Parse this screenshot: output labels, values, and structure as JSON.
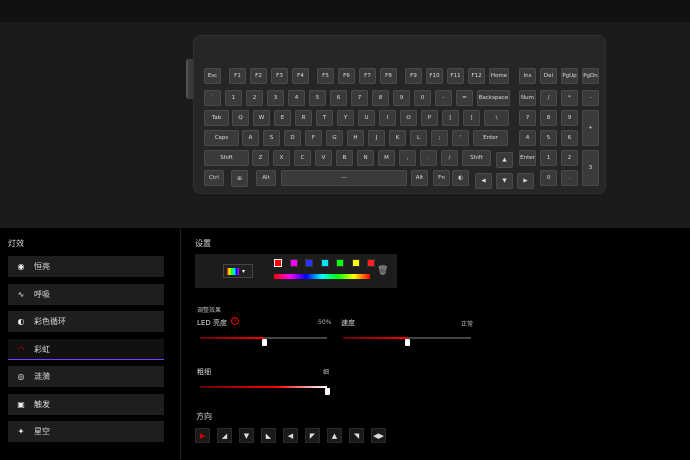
{
  "keyboard": {
    "rows": [
      [
        "Esc",
        "F1",
        "F2",
        "F3",
        "F4",
        "F5",
        "F6",
        "F7",
        "F8",
        "F9",
        "F10",
        "F11",
        "F12",
        "Home",
        "Ins",
        "Del",
        "PgUp",
        "PgDn"
      ],
      [
        "`",
        "1",
        "2",
        "3",
        "4",
        "5",
        "6",
        "7",
        "8",
        "9",
        "0",
        "-",
        "=",
        "Backspace",
        "Num",
        "/",
        "*",
        "-"
      ],
      [
        "Tab",
        "Q",
        "W",
        "E",
        "R",
        "T",
        "Y",
        "U",
        "I",
        "O",
        "P",
        "[",
        "]",
        "\\",
        "7",
        "8",
        "9",
        "+"
      ],
      [
        "Caps",
        "A",
        "S",
        "D",
        "F",
        "G",
        "H",
        "J",
        "K",
        "L",
        ";",
        "'",
        "Enter",
        "4",
        "5",
        "6"
      ],
      [
        "Shift",
        "Z",
        "X",
        "C",
        "V",
        "B",
        "N",
        "M",
        ",",
        ".",
        "/",
        "Shift",
        "▲",
        "1",
        "2",
        "3",
        "Enter"
      ],
      [
        "Ctrl",
        "⊞",
        "Alt",
        "—",
        "Alt",
        "Fn",
        "◐",
        "◀",
        "▼",
        "▶",
        "0",
        "."
      ]
    ]
  },
  "left_panel": {
    "title": "灯效",
    "effects": [
      {
        "label": "恒亮",
        "icon": "circle-dot-icon"
      },
      {
        "label": "呼吸",
        "icon": "wave-icon"
      },
      {
        "label": "彩色循环",
        "icon": "cycle-icon"
      },
      {
        "label": "彩虹",
        "icon": "rainbow-icon"
      },
      {
        "label": "涟漪",
        "icon": "ripple-icon"
      },
      {
        "label": "触发",
        "icon": "trigger-icon"
      },
      {
        "label": "星空",
        "icon": "starry-icon"
      }
    ],
    "active_index": 3
  },
  "right_panel": {
    "settings_title": "设置",
    "color_swatches": [
      "#ff0000",
      "#ff00ff",
      "#3030ff",
      "#00e5ff",
      "#00ff00",
      "#ffff00",
      "#ff2020"
    ],
    "adjust_title": "调整效果",
    "brightness_label": "LED 亮度",
    "brightness_value": "50%",
    "brightness_level": 0.5,
    "speed_label": "速度",
    "speed_value": "正常",
    "speed_level": 0.5,
    "width_label": "粗细",
    "width_value": "细",
    "width_level": 1.0,
    "direction_title": "方向",
    "directions": [
      "▶",
      "◢",
      "▼",
      "◣",
      "◀",
      "◤",
      "▲",
      "◥",
      "◀▶"
    ]
  },
  "colors": {
    "accent": "#e00000",
    "active_border": "#7a3cff"
  }
}
